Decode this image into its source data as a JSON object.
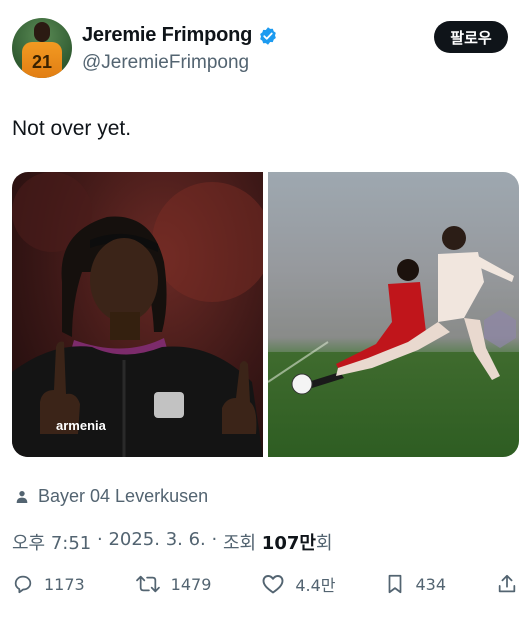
{
  "user": {
    "display_name": "Jeremie Frimpong",
    "handle": "@JeremieFrimpong",
    "avatar_number": "21",
    "verified": true
  },
  "follow_label": "팔로우",
  "tweet": {
    "text": "Not over yet."
  },
  "photo_left": {
    "sponsor_text": "armenia"
  },
  "location": "Bayer 04 Leverkusen",
  "meta": {
    "time": "오후 7:51",
    "date": "2025. 3. 6.",
    "views_prefix": "조회",
    "views_value": "107만",
    "views_suffix": "회"
  },
  "actions": {
    "replies": "1173",
    "reposts": "1479",
    "likes": "4.4만",
    "bookmarks": "434"
  },
  "colors": {
    "text": "#0f1419",
    "muted": "#536471",
    "verified": "#1d9bf0",
    "follow_bg": "#0f1419"
  }
}
